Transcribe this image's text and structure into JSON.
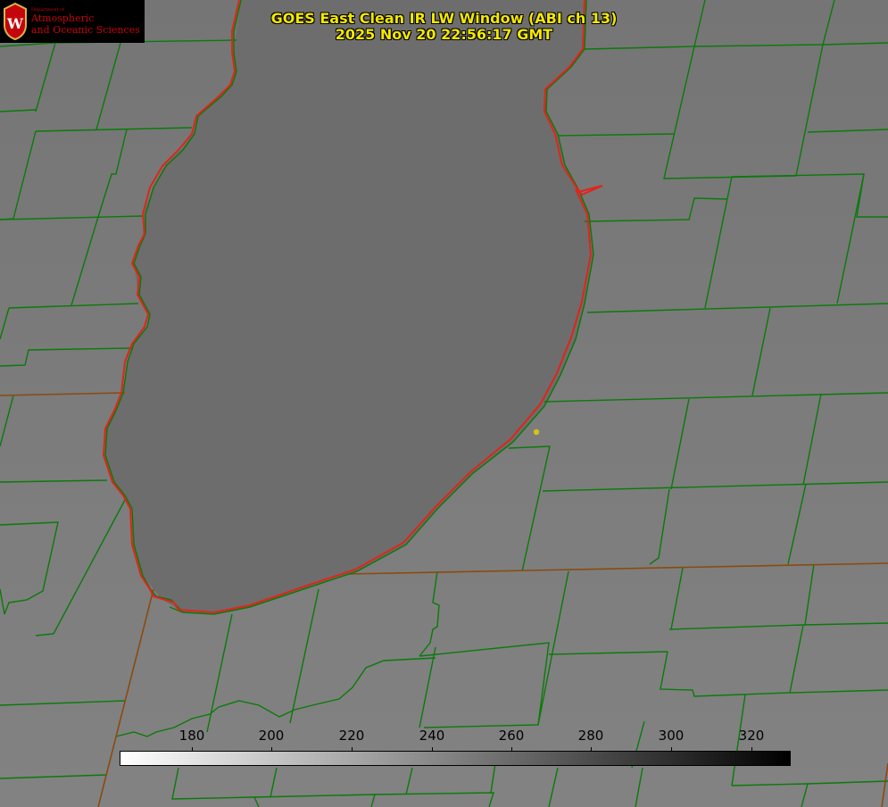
{
  "title": {
    "line1": "GOES East Clean IR LW Window (ABI ch 13)",
    "line2": "2025 Nov 20 22:56:17 GMT"
  },
  "logo": {
    "dept": "Department of",
    "line1": "Atmospheric",
    "line2": "and Oceanic Sciences",
    "shield_letter": "W"
  },
  "colors": {
    "background": "#7b7b7b",
    "lake": "#6d6d6d",
    "county_lines": "#0a7a0a",
    "coastline": "#e0281e",
    "title_text": "#f4e800",
    "logo_red": "#c5050c",
    "marker": "#d4c21a"
  },
  "colorbar": {
    "ticks": [
      "180",
      "200",
      "220",
      "240",
      "260",
      "280",
      "300",
      "320"
    ],
    "gradient_from": "#ffffff",
    "gradient_to": "#000000"
  }
}
